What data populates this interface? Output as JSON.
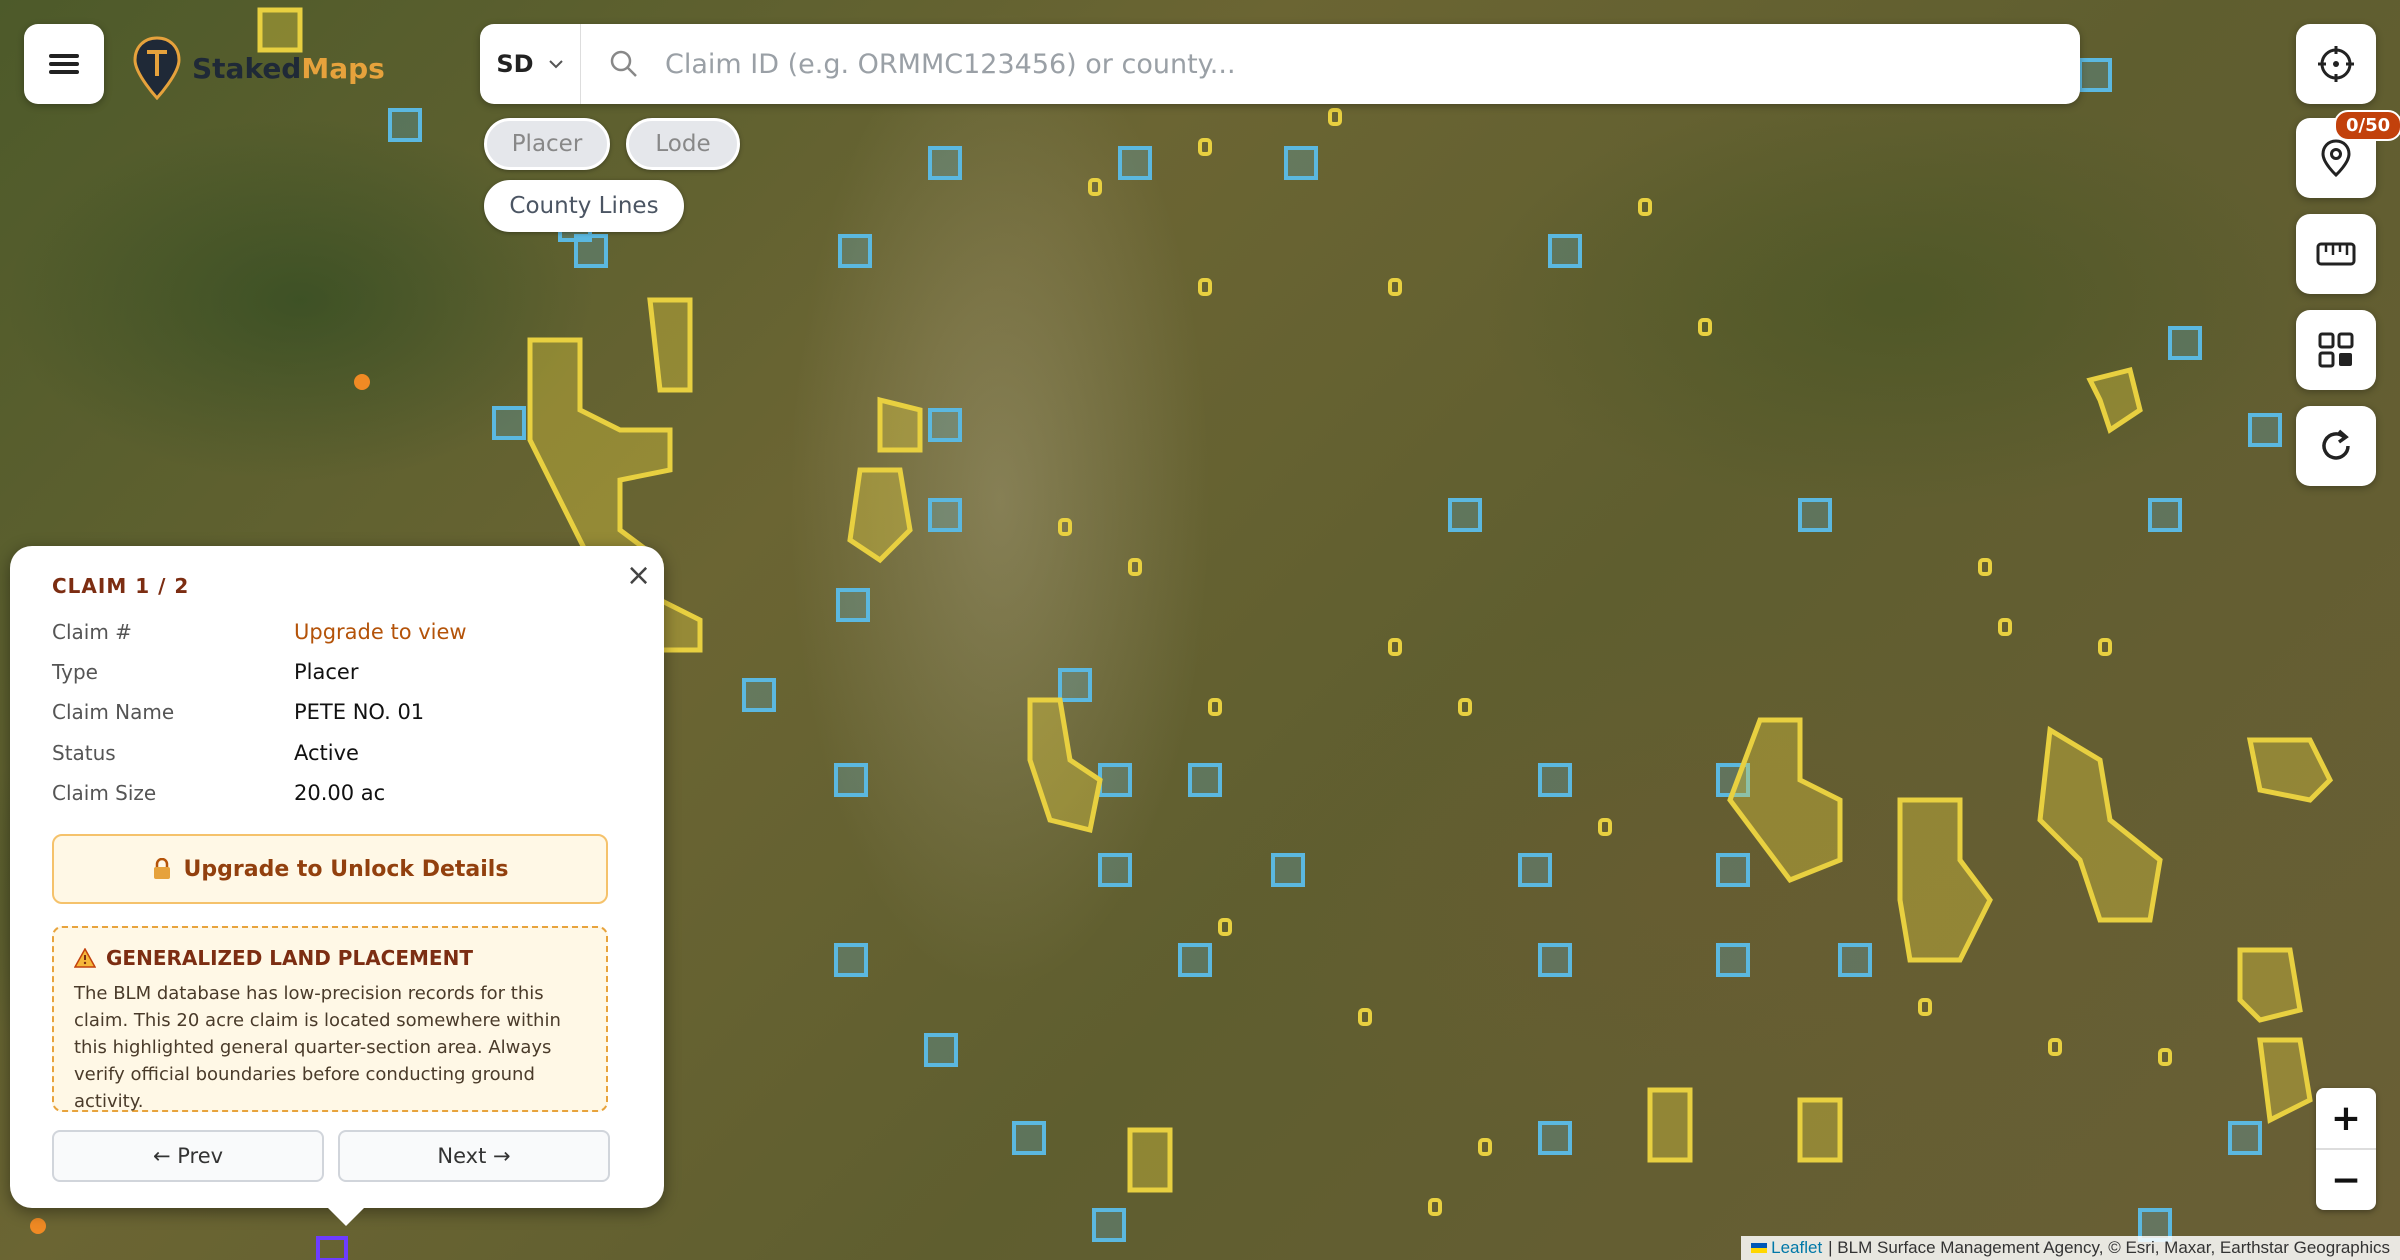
{
  "app": {
    "brand_part1": "Staked",
    "brand_part2": "Maps"
  },
  "colors": {
    "placer": "#e8d040",
    "lode": "#5bb8e0",
    "accent": "#e6a23c",
    "badge": "#c2410c"
  },
  "search": {
    "state": "SD",
    "placeholder": "Claim ID (e.g. ORMMC123456) or county..."
  },
  "filters": [
    {
      "label": "Placer",
      "active": false
    },
    {
      "label": "Lode",
      "active": false
    },
    {
      "label": "County Lines",
      "active": true
    }
  ],
  "right_toolbar": {
    "buttons": [
      "locate-icon",
      "pin-icon",
      "ruler-icon",
      "grid-icon",
      "refresh-icon"
    ],
    "pin_badge": "0/50"
  },
  "zoom": {
    "in": "+",
    "out": "−"
  },
  "attribution": {
    "leaflet": "Leaflet",
    "rest": "| BLM Surface Management Agency, © Esri, Maxar, Earthstar Geographics"
  },
  "popup": {
    "heading": "CLAIM 1 / 2",
    "close": "×",
    "fields": [
      {
        "key": "Claim #",
        "value": "Upgrade to view"
      },
      {
        "key": "Type",
        "value": "Placer"
      },
      {
        "key": "Claim Name",
        "value": "PETE NO. 01"
      },
      {
        "key": "Status",
        "value": "Active"
      },
      {
        "key": "Claim Size",
        "value": "20.00 ac"
      }
    ],
    "upgrade_button": "Upgrade to Unlock Details",
    "notice": {
      "title": "GENERALIZED LAND PLACEMENT",
      "text": "The BLM database has low-precision records for this claim. This 20 acre claim is located somewhere within this highlighted general quarter-section area. Always verify official boundaries before conducting ground activity."
    },
    "prev": "← Prev",
    "next": "Next →"
  }
}
